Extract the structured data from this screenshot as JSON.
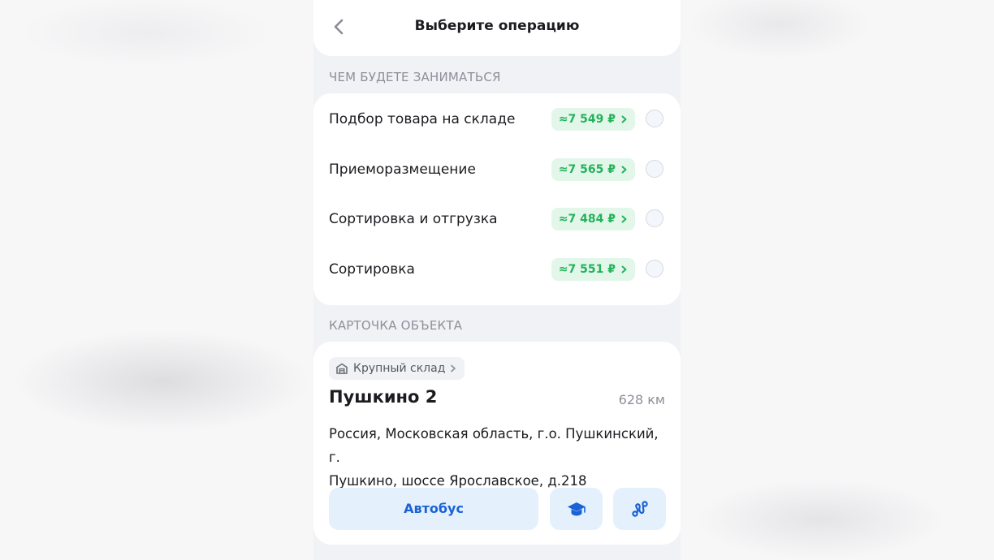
{
  "header": {
    "title": "Выберите операцию",
    "back_icon": "chevron-left-icon"
  },
  "operations_section": {
    "title": "ЧЕМ БУДЕТЕ ЗАНИМАТЬСЯ",
    "items": [
      {
        "label": "Подбор товара на складе",
        "price": "≈7 549 ₽",
        "selected": false
      },
      {
        "label": "Приеморазмещение",
        "price": "≈7 565 ₽",
        "selected": false
      },
      {
        "label": "Сортировка и отгрузка",
        "price": "≈7 484 ₽",
        "selected": false
      },
      {
        "label": "Сортировка",
        "price": "≈7 551 ₽",
        "selected": false
      }
    ]
  },
  "object_section": {
    "title": "КАРТОЧКА ОБЪЕКТА",
    "type_chip": "Крупный склад",
    "type_icon": "warehouse-icon",
    "name": "Пушкино 2",
    "distance": "628 км",
    "address_line1": "Россия, Московская область, г.о. Пушкинский, г.",
    "address_line2": "Пушкино, шоссе Ярославское, д.218",
    "transport_button": "Автобус",
    "training_icon": "graduation-cap-icon",
    "route_icon": "route-icon"
  },
  "colors": {
    "accent_blue": "#1a62d6",
    "price_green": "#22b35a",
    "price_bg": "#e3f6ea",
    "button_bg": "#e4f1fd"
  }
}
